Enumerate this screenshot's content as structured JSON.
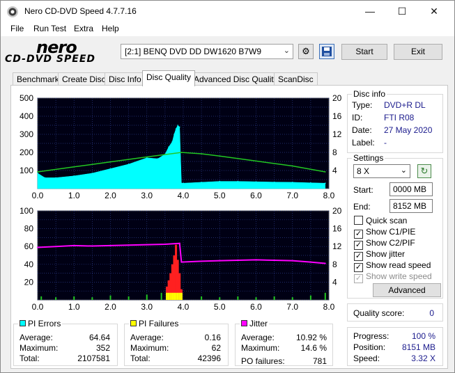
{
  "window": {
    "title": "Nero CD-DVD Speed 4.7.7.16"
  },
  "menu": [
    "File",
    "Run Test",
    "Extra",
    "Help"
  ],
  "logo": {
    "brand": "nero",
    "product": "CD-DVD SPEED"
  },
  "toolbar": {
    "drive": "[2:1]   BENQ DVD DD DW1620 B7W9",
    "start_label": "Start",
    "exit_label": "Exit"
  },
  "tabs": [
    "Benchmark",
    "Create Disc",
    "Disc Info",
    "Disc Quality",
    "Advanced Disc Quality",
    "ScanDisc"
  ],
  "active_tab": "Disc Quality",
  "disc_info": {
    "title": "Disc info",
    "type_label": "Type:",
    "type": "DVD+R DL",
    "id_label": "ID:",
    "id": "FTI R08",
    "date_label": "Date:",
    "date": "27 May 2020",
    "label_label": "Label:",
    "label": "-"
  },
  "settings": {
    "title": "Settings",
    "speed": "8 X",
    "start_label": "Start:",
    "start": "0000 MB",
    "end_label": "End:",
    "end": "8152 MB",
    "checks": [
      {
        "label": "Quick scan",
        "checked": false,
        "enabled": true
      },
      {
        "label": "Show C1/PIE",
        "checked": true,
        "enabled": true
      },
      {
        "label": "Show C2/PIF",
        "checked": true,
        "enabled": true
      },
      {
        "label": "Show jitter",
        "checked": true,
        "enabled": true
      },
      {
        "label": "Show read speed",
        "checked": true,
        "enabled": true
      },
      {
        "label": "Show write speed",
        "checked": true,
        "enabled": false
      }
    ],
    "advanced_label": "Advanced"
  },
  "quality": {
    "label": "Quality score:",
    "value": "0"
  },
  "progress": {
    "progress_label": "Progress:",
    "progress": "100 %",
    "position_label": "Position:",
    "position": "8151 MB",
    "speed_label": "Speed:",
    "speed": "3.32 X"
  },
  "stats": {
    "pi_errors": {
      "title": "PI Errors",
      "color": "#00ffff",
      "average_label": "Average:",
      "average": "64.64",
      "maximum_label": "Maximum:",
      "maximum": "352",
      "total_label": "Total:",
      "total": "2107581"
    },
    "pi_failures": {
      "title": "PI Failures",
      "color": "#ffff00",
      "average_label": "Average:",
      "average": "0.16",
      "maximum_label": "Maximum:",
      "maximum": "62",
      "total_label": "Total:",
      "total": "42396"
    },
    "jitter": {
      "title": "Jitter",
      "color": "#ff00ff",
      "average_label": "Average:",
      "average": "10.92 %",
      "maximum_label": "Maximum:",
      "maximum": "14.6 %",
      "po_label": "PO failures:",
      "po": "781"
    }
  },
  "chart_data": [
    {
      "type": "area",
      "xlim": [
        0,
        8.0
      ],
      "ylim": [
        0,
        500
      ],
      "y2lim": [
        0,
        20
      ],
      "x_ticks": [
        "0.0",
        "1.0",
        "2.0",
        "3.0",
        "4.0",
        "5.0",
        "6.0",
        "7.0",
        "8.0"
      ],
      "y_ticks": [
        "100",
        "200",
        "300",
        "400",
        "500"
      ],
      "y2_ticks": [
        "4",
        "8",
        "12",
        "16",
        "20"
      ],
      "grid": true,
      "series": [
        {
          "role": "pi_errors",
          "color": "#00ffff",
          "x": [
            0.0,
            0.2,
            0.5,
            1.0,
            1.5,
            2.0,
            2.5,
            3.0,
            3.3,
            3.5,
            3.6,
            3.7,
            3.75,
            3.8,
            3.85,
            3.9,
            3.95,
            4.0,
            4.5,
            5.0,
            5.5,
            6.0,
            6.5,
            7.0,
            7.5,
            7.9
          ],
          "y": [
            85,
            60,
            60,
            70,
            85,
            110,
            135,
            170,
            165,
            190,
            230,
            260,
            300,
            330,
            350,
            340,
            30,
            30,
            35,
            40,
            40,
            38,
            36,
            35,
            32,
            30
          ]
        },
        {
          "role": "read_speed",
          "color": "#22c822",
          "x": [
            0.0,
            1.0,
            2.0,
            3.0,
            3.95,
            4.5,
            5.0,
            6.0,
            7.0,
            7.9
          ],
          "y": [
            3.7,
            4.8,
            5.9,
            7.0,
            8.0,
            7.7,
            7.2,
            6.1,
            5.0,
            3.7
          ]
        }
      ]
    },
    {
      "type": "bar",
      "xlim": [
        0,
        8.0
      ],
      "ylim": [
        0,
        100
      ],
      "y2lim": [
        0,
        20
      ],
      "x_ticks": [
        "0.0",
        "1.0",
        "2.0",
        "3.0",
        "4.0",
        "5.0",
        "6.0",
        "7.0",
        "8.0"
      ],
      "y_ticks": [
        "20",
        "40",
        "60",
        "80",
        "100"
      ],
      "y2_ticks": [
        "4",
        "8",
        "12",
        "16",
        "20"
      ],
      "grid": true,
      "series": [
        {
          "role": "pi_failures",
          "color": "#ff2020",
          "x": [
            3.55,
            3.6,
            3.65,
            3.7,
            3.75,
            3.8,
            3.85,
            3.9,
            3.95
          ],
          "y": [
            15,
            22,
            30,
            40,
            50,
            62,
            45,
            30,
            12
          ]
        },
        {
          "role": "pi_failures_low",
          "color": "#22c822",
          "x": [
            0.1,
            0.5,
            1.0,
            1.5,
            2.0,
            2.5,
            3.0,
            3.4,
            4.5,
            5.0,
            5.5,
            6.0,
            6.5,
            7.0,
            7.5,
            7.9
          ],
          "y": [
            4,
            3,
            4,
            3,
            5,
            4,
            6,
            8,
            4,
            3,
            4,
            3,
            4,
            3,
            5,
            8
          ]
        },
        {
          "role": "jitter",
          "color": "#ff00ff",
          "x": [
            0.0,
            0.5,
            1.0,
            1.5,
            2.0,
            2.5,
            3.0,
            3.5,
            3.9,
            3.95,
            4.5,
            5.0,
            5.5,
            6.0,
            6.5,
            7.0,
            7.5,
            7.9
          ],
          "y": [
            11.8,
            12.0,
            12.2,
            12.1,
            12.2,
            12.3,
            12.4,
            12.5,
            12.7,
            8.5,
            8.7,
            8.8,
            8.9,
            9.0,
            8.9,
            8.8,
            8.5,
            8.2
          ]
        }
      ]
    }
  ]
}
